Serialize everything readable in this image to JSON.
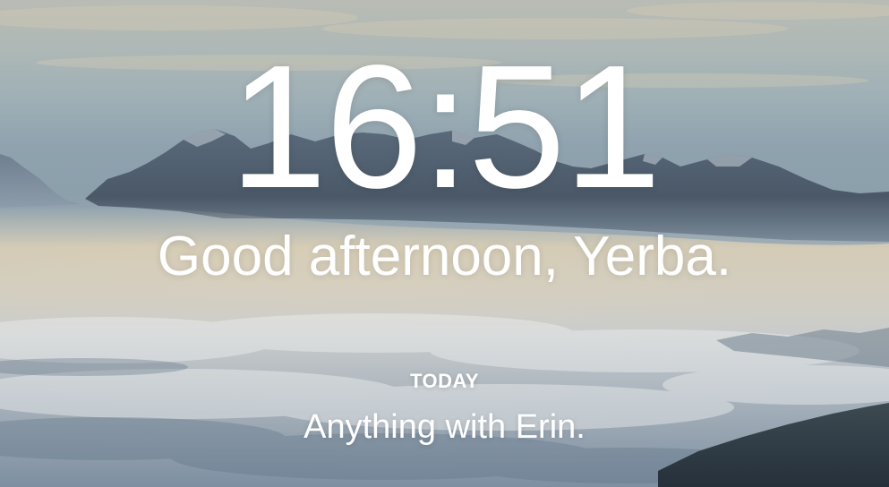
{
  "clock": {
    "time": "16:51"
  },
  "greeting": {
    "text": "Good afternoon, Yerba."
  },
  "focus": {
    "label": "TODAY",
    "text": "Anything with Erin."
  },
  "colors": {
    "text": "#ffffff",
    "sky_top": "#b9bcb4",
    "horizon_glow": "#e3cfa9",
    "mountain": "#4b5b6b",
    "cloud_sea": "#8094a6"
  }
}
